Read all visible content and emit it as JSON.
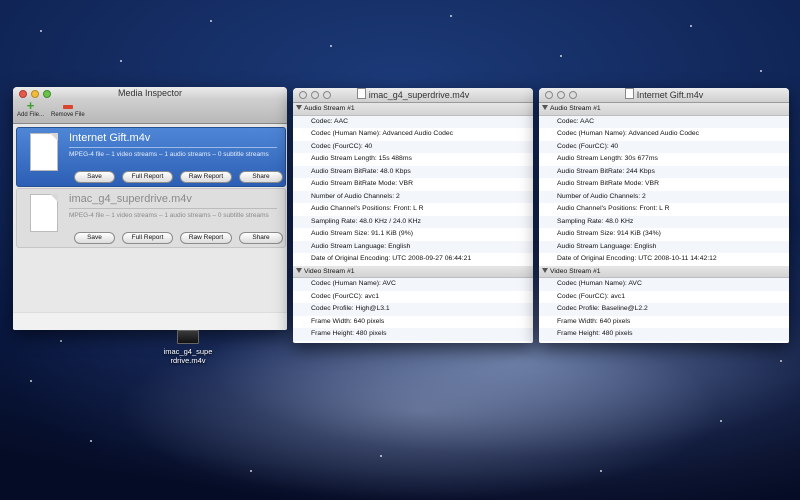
{
  "media_inspector": {
    "title": "Media Inspector",
    "toolbar": {
      "add_label": "Add File...",
      "remove_label": "Remove File"
    },
    "buttons": {
      "save": "Save",
      "full": "Full Report",
      "raw": "Raw Report",
      "share": "Share"
    },
    "files": [
      {
        "name": "Internet Gift.m4v",
        "info": "MPEG-4 file – 1 video streams – 1 audio streams – 0 subtitle streams"
      },
      {
        "name": "imac_g4_superdrive.m4v",
        "info": "MPEG-4 file – 1 video streams – 1 audio streams – 0 subtitle streams"
      }
    ]
  },
  "window2": {
    "title": "imac_g4_superdrive.m4v",
    "audio_header": "Audio Stream #1",
    "audio": [
      "Codec: AAC",
      "Codec (Human Name): Advanced Audio Codec",
      "Codec (FourCC): 40",
      "Audio Stream Length: 15s 488ms",
      "Audio Stream BitRate: 48.0 Kbps",
      "Audio Stream BitRate Mode: VBR",
      "Number of Audio Channels: 2",
      "Audio Channel's Positions: Front: L R",
      "Sampling Rate: 48.0 KHz / 24.0 KHz",
      "Audio Stream Size: 91.1 KiB (9%)",
      "Audio Stream Language: English",
      "Date of Original Encoding: UTC 2008-09-27 06:44:21"
    ],
    "video_header": "Video Stream #1",
    "video": [
      "Codec (Human Name): AVC",
      "Codec (FourCC): avc1",
      "Codec Profile: High@L3.1",
      "Frame Width: 640 pixels",
      "Frame Height: 480 pixels"
    ]
  },
  "window3": {
    "title": "Internet Gift.m4v",
    "audio_header": "Audio Stream #1",
    "audio": [
      "Codec: AAC",
      "Codec (Human Name): Advanced Audio Codec",
      "Codec (FourCC): 40",
      "Audio Stream Length: 30s 677ms",
      "Audio Stream BitRate: 244 Kbps",
      "Audio Stream BitRate Mode: VBR",
      "Number of Audio Channels: 2",
      "Audio Channel's Positions: Front: L R",
      "Sampling Rate: 48.0 KHz",
      "Audio Stream Size: 914 KiB (34%)",
      "Audio Stream Language: English",
      "Date of Original Encoding: UTC 2008-10-11 14:42:12"
    ],
    "video_header": "Video Stream #1",
    "video": [
      "Codec (Human Name): AVC",
      "Codec (FourCC): avc1",
      "Codec Profile: Baseline@L2.2",
      "Frame Width: 640 pixels",
      "Frame Height: 480 pixels"
    ]
  },
  "desktop_file": {
    "label_line1": "imac_g4_supe",
    "label_line2": "rdrive.m4v"
  }
}
